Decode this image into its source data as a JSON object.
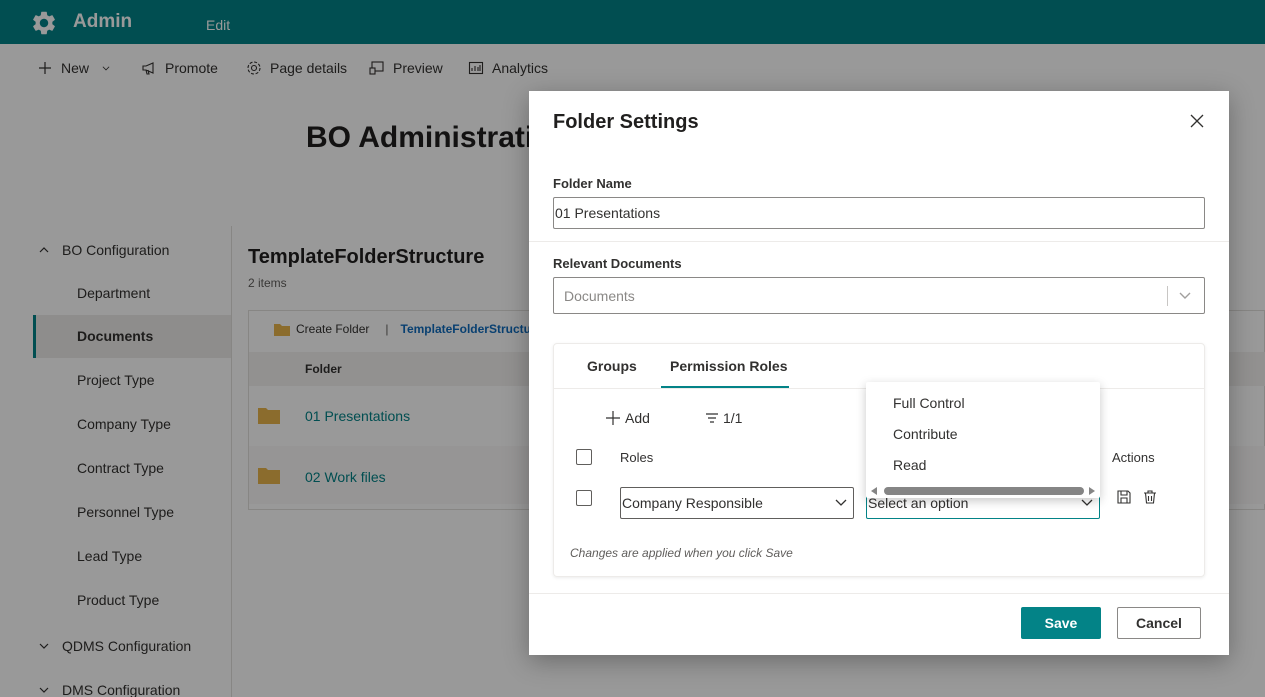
{
  "colors": {
    "accent": "#038387",
    "overlay": "rgba(0,0,0,0.4)"
  },
  "suitebar": {
    "site_title": "Admin",
    "edit": "Edit",
    "icon": "gear-icon"
  },
  "commandbar": {
    "new": "New",
    "promote": "Promote",
    "page_details": "Page details",
    "preview": "Preview",
    "analytics": "Analytics"
  },
  "page": {
    "title": "BO Administration"
  },
  "nav": {
    "groups": [
      "BO Configuration",
      "QDMS Configuration",
      "DMS Configuration"
    ],
    "items": [
      "Department",
      "Documents",
      "Project Type",
      "Company Type",
      "Contract Type",
      "Personnel Type",
      "Lead Type",
      "Product Type"
    ],
    "active": "Documents"
  },
  "library": {
    "title": "TemplateFolderStructure",
    "count": "2 items",
    "create_folder": "Create Folder",
    "separator": "|",
    "breadcrumb": "TemplateFolderStructure",
    "column_folder": "Folder",
    "rows": [
      "01 Presentations",
      "02 Work files"
    ]
  },
  "dialog": {
    "title": "Folder Settings",
    "folder_name_label": "Folder Name",
    "folder_name_value": "01 Presentations",
    "relevant_documents_label": "Relevant Documents",
    "documents_placeholder": "Documents",
    "tabs": [
      "Groups",
      "Permission Roles"
    ],
    "active_tab": "Permission Roles",
    "add": "Add",
    "filter_count": "1/1",
    "col_roles": "Roles",
    "col_actions": "Actions",
    "role_value": "Company Responsible",
    "permission_placeholder": "Select an option",
    "hint": "Changes are applied when you click Save",
    "save": "Save",
    "cancel": "Cancel",
    "dropdown_options": [
      "Full Control",
      "Contribute",
      "Read"
    ]
  }
}
